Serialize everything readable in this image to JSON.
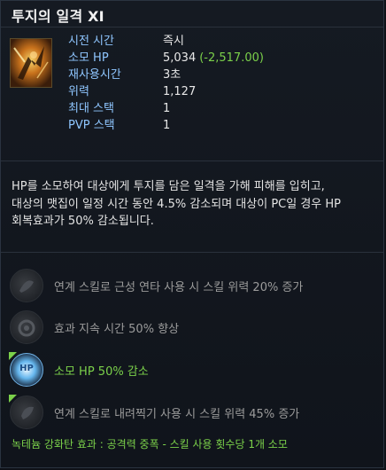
{
  "title": "투지의 일격 XI",
  "stats": [
    {
      "label": "시전 시간",
      "value": "즉시",
      "extra": ""
    },
    {
      "label": "소모 HP",
      "value": "5,034",
      "extra": "(-2,517.00)"
    },
    {
      "label": "재사용시간",
      "value": "3초",
      "extra": ""
    },
    {
      "label": "위력",
      "value": "1,127",
      "extra": ""
    },
    {
      "label": "최대 스택",
      "value": "1",
      "extra": ""
    },
    {
      "label": "PVP 스택",
      "value": "1",
      "extra": ""
    }
  ],
  "description": {
    "line1": "HP를 소모하여 대상에게 투지를 담은 일격을 가해 피해를 입히고,",
    "line2": "대상의 맷집이 일정 시간 동안 4.5% 감소되며 대상이 PC일 경우 HP",
    "line3": "회복효과가 50% 감소됩니다."
  },
  "tripods": [
    {
      "text": "연계 스킬로 근성 연타 사용 시 스킬 위력 20% 증가",
      "icon": "combo-icon",
      "active": false
    },
    {
      "text": "효과 지속 시간 50% 향상",
      "icon": "duration-icon",
      "active": false
    },
    {
      "text": "소모 HP 50% 감소",
      "icon": "hp-icon",
      "icon_label": "HP",
      "active": true
    },
    {
      "text": "연계 스킬로 내려찍기 사용 시 스킬 위력 45% 증가",
      "icon": "combo-icon",
      "active": false
    }
  ],
  "footer": "녹테늄 강화탄 효과 : 공격력 중폭 - 스킬 사용 횟수당 1개 소모",
  "colors": {
    "label": "#8fc6ff",
    "active": "#7bd14a",
    "inactive": "#9b9b9b"
  }
}
